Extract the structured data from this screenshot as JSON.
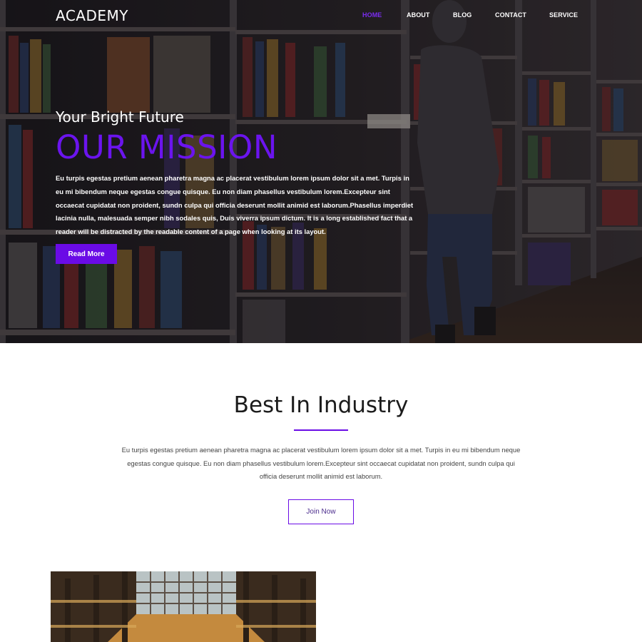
{
  "brand": {
    "logo": "ACADEMY"
  },
  "nav": {
    "items": [
      {
        "label": "HOME",
        "color": "#7b2cf0",
        "active": true
      },
      {
        "label": "ABOUT",
        "color": "#ffffff"
      },
      {
        "label": "BLOG",
        "color": "#ffffff"
      },
      {
        "label": "CONTACT",
        "color": "#ffffff"
      },
      {
        "label": "SERVICE",
        "color": "#ffffff"
      }
    ]
  },
  "hero": {
    "subtitle": "Your Bright Future",
    "title": "OUR MISSION",
    "text": "Eu turpis egestas pretium aenean pharetra magna ac placerat vestibulum lorem ipsum dolor sit a met. Turpis in eu mi bibendum neque egestas congue quisque. Eu non diam phasellus vestibulum lorem.Excepteur sint occaecat cupidatat non proident, sundn culpa qui officia deserunt mollit animid est laborum.Phasellus imperdiet lacinia nulla, malesuada semper nibh sodales quis, Duis viverra ipsum dictum. It is a long established fact that a reader will be distracted by the readable content of a page when looking at its layout.",
    "button_label": "Read More",
    "accent_color": "#6a0be6"
  },
  "industry": {
    "title": "Best In Industry",
    "text": "Eu turpis egestas pretium aenean pharetra magna ac placerat vestibulum lorem ipsum dolor sit a met. Turpis in eu mi bibendum neque egestas congue quisque. Eu non diam phasellus vestibulum lorem.Excepteur sint occaecat cupidatat non proident, sundn culpa qui officia deserunt mollit animid est laborum.",
    "button_label": "Join Now"
  }
}
